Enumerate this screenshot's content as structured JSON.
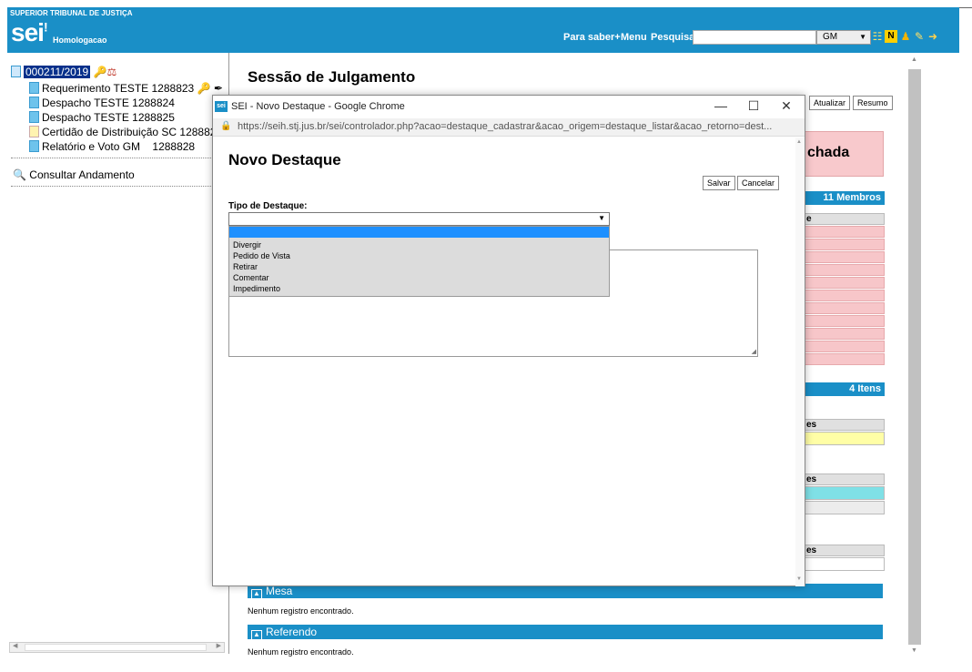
{
  "header": {
    "org": "SUPERIOR TRIBUNAL DE JUSTIÇA",
    "logo": "sei",
    "logo_mark": "!",
    "env": "Homologacao",
    "nav": [
      "Para saber+",
      "Menu",
      "Pesquisa"
    ],
    "search_value": "",
    "unit": "GM",
    "icons": [
      "list-icon",
      "notification-icon",
      "user-icon",
      "tools-icon",
      "exit-icon"
    ]
  },
  "tree": {
    "process": "000211/2019",
    "items": [
      {
        "label": "Requerimento TESTE 1288823"
      },
      {
        "label": "Despacho TESTE 1288824"
      },
      {
        "label": "Despacho TESTE 1288825"
      },
      {
        "label": "Certidão de Distribuição SC 128882"
      },
      {
        "label": "Relatório e Voto GM    1288828"
      }
    ],
    "consult": "Consultar Andamento"
  },
  "main": {
    "title": "Sessão de Julgamento",
    "btn_update": "Atualizar",
    "btn_summary": "Resumo",
    "status": "chada",
    "members": "11 Membros",
    "members_col": "e",
    "items": "4 Itens",
    "col_a": "es",
    "col_b": "es",
    "col_c": "es",
    "sections": [
      {
        "label": "Mesa",
        "empty": "Nenhum registro encontrado."
      },
      {
        "label": "Referendo",
        "empty": "Nenhum registro encontrado."
      }
    ]
  },
  "dialog": {
    "window_title": "SEI - Novo Destaque - Google Chrome",
    "favicon": "sei",
    "url": "https://seih.stj.jus.br/sei/controlador.php?acao=destaque_cadastrar&acao_origem=destaque_listar&acao_retorno=dest...",
    "title": "Novo Destaque",
    "save": "Salvar",
    "cancel": "Cancelar",
    "field_label": "Tipo de Destaque:",
    "selected": "",
    "options": [
      "",
      "Divergir",
      "Pedido de Vista",
      "Retirar",
      "Comentar",
      "Impedimento"
    ],
    "highlight_color": "#1e90ff"
  },
  "colors": {
    "brand": "#1a8fc7",
    "pink": "#f8c9cc",
    "yellow": "#fffea6",
    "cyan": "#7fe0e6"
  }
}
